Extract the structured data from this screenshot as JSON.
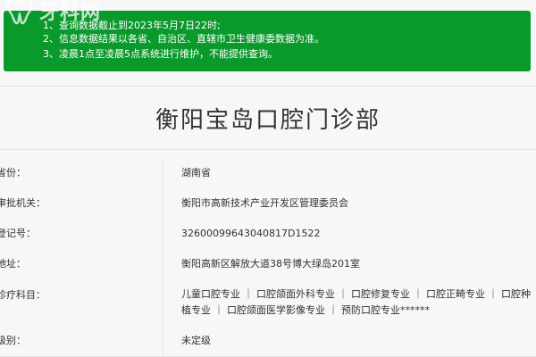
{
  "notice": {
    "line1": "1、查询数据截止到2023年5月7日22时;",
    "line2": "2、信息数据结果以各省、自治区、直辖市卫生健康委数据为准。",
    "line3": "3、凌晨1点至凌晨5点系统进行维护，不能提供查询。"
  },
  "watermark": {
    "text": "牙科网",
    "icon": "tooth-logo-icon"
  },
  "title": "衡阳宝岛口腔门诊部",
  "details": {
    "province_label": "省份：",
    "province_value": "湖南省",
    "authority_label": "审批机关：",
    "authority_value": "衡阳市高新技术产业开发区管理委员会",
    "reg_label": "登记号：",
    "reg_value": "32600099643040817D1522",
    "address_label": "地址：",
    "address_value": "衡阳高新区解放大道38号博大绿岛201室",
    "subjects_label": "诊疗科目：",
    "subjects_value": "儿童口腔专业 ｜ 口腔颌面外科专业 ｜ 口腔修复专业 ｜ 口腔正畸专业 ｜ 口腔种植专业 ｜ 口腔颌面医学影像专业 ｜ 预防口腔专业******",
    "level_label": "级别：",
    "level_value": "未定级"
  },
  "colors": {
    "notice_bg": "#0a9a2c",
    "page_bg": "#f6f7f6",
    "border": "#e3e5e3",
    "text": "#333333"
  }
}
